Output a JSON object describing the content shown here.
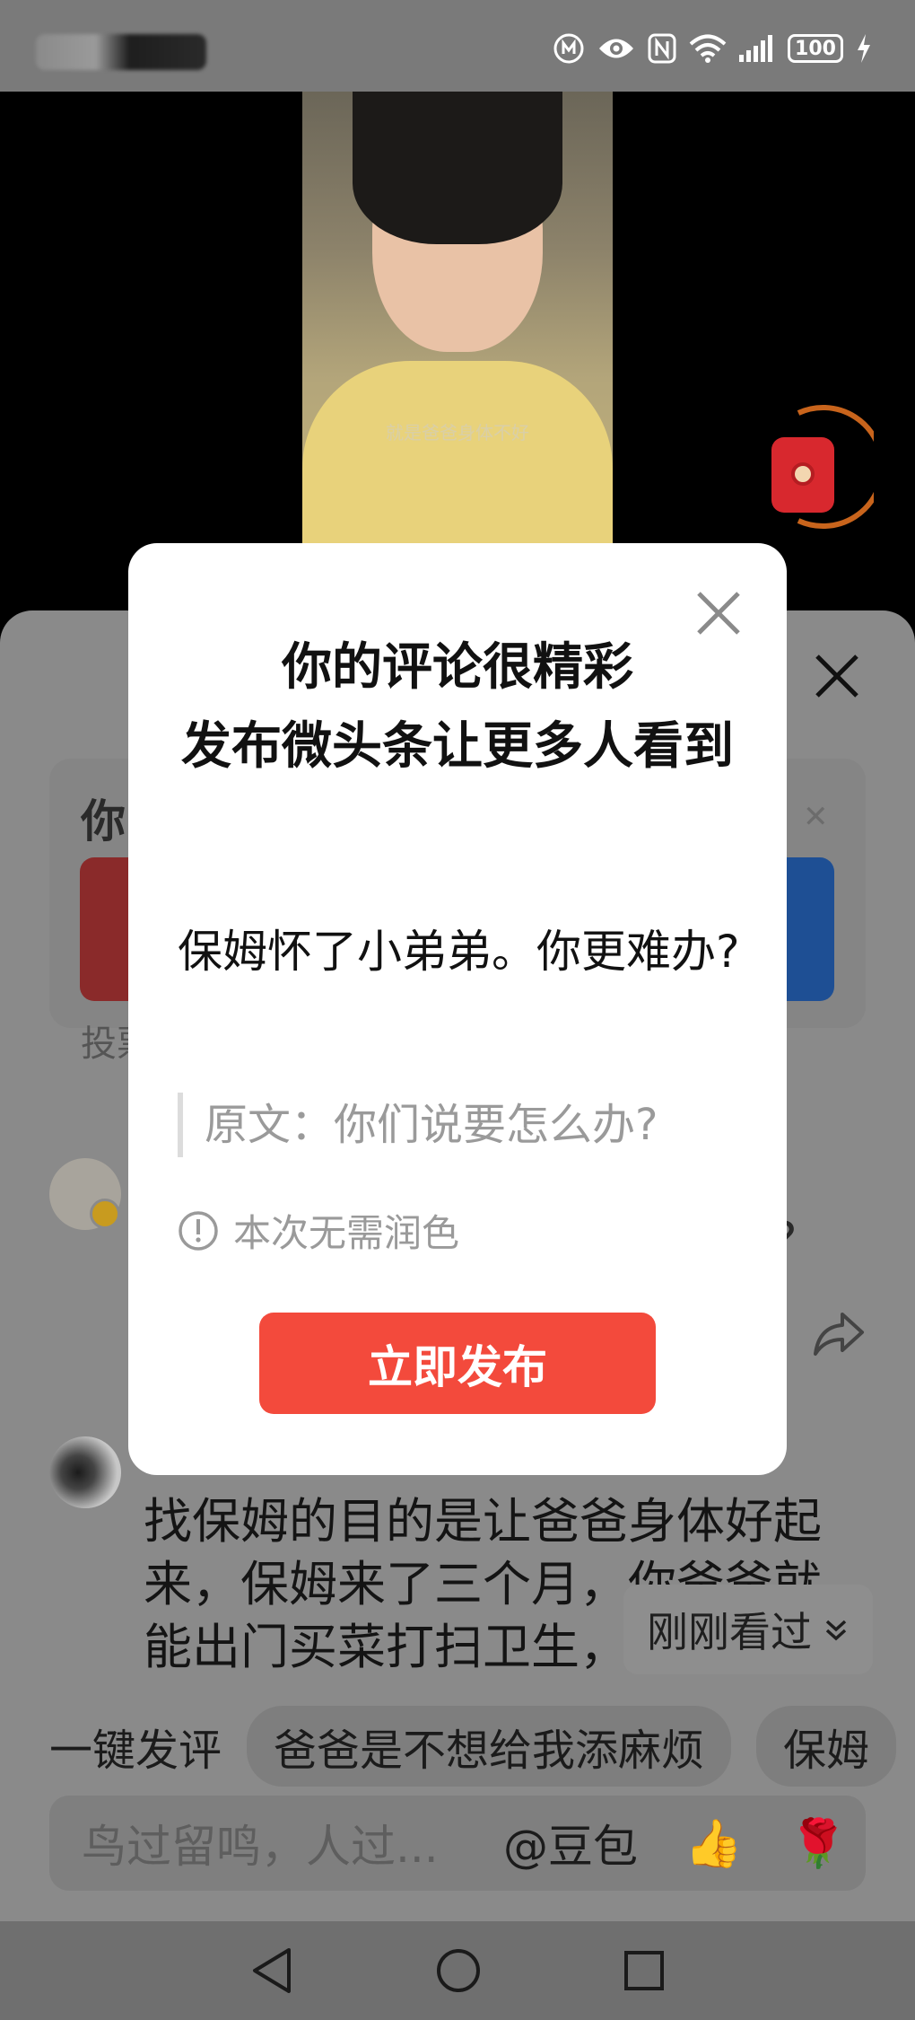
{
  "status_bar": {
    "battery": "100"
  },
  "video": {
    "subtitle": "就是爸爸身体不好"
  },
  "poll": {
    "title": "你",
    "footer": "投票"
  },
  "comment": {
    "trailing": "?",
    "text": "找保姆的目的是让爸爸身体好起来，保姆来了三个月，你爸爸就能出门买菜打扫卫生，就"
  },
  "recent_chip": {
    "label": "刚刚看过"
  },
  "quick_comments": {
    "label": "一键发评",
    "chips": [
      "爸爸是不想给我添麻烦",
      "保姆"
    ]
  },
  "input": {
    "placeholder": "鸟过留鸣，人过...",
    "mention": "@豆包",
    "emoji_thumb": "👍",
    "emoji_rose": "🌹"
  },
  "modal": {
    "title_line1": "你的评论很精彩",
    "title_line2": "发布微头条让更多人看到",
    "body": "保姆怀了小弟弟。你更难办?",
    "quote": "原文：你们说要怎么办?",
    "notice": "本次无需润色",
    "publish_button": "立即发布"
  },
  "colors": {
    "publish_red": "#f34a3c",
    "poll_blue": "#1e4f94",
    "envelope_red": "#d8282e"
  }
}
